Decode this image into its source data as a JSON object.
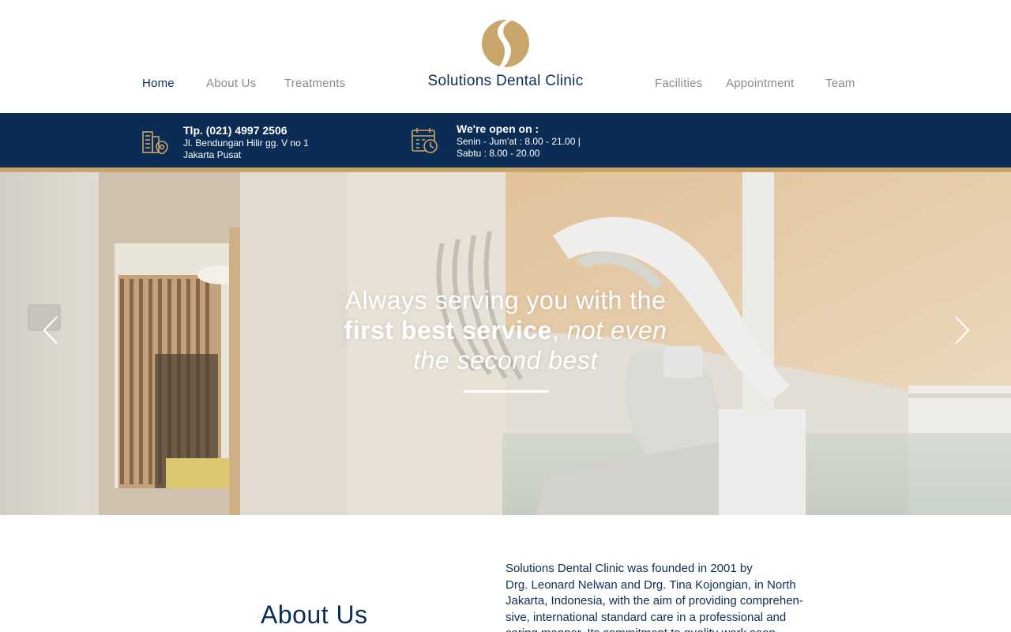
{
  "nav": {
    "left": [
      "Home",
      "About Us",
      "Treatments"
    ],
    "right": [
      "Facilities",
      "Appointment",
      "Team"
    ],
    "active": "Home"
  },
  "brand": {
    "name": "Solutions Dental Clinic",
    "logo_icon": "s-swirl-logo-icon",
    "gold": "#c8a66a",
    "navy": "#0b2d55"
  },
  "contact": {
    "phone": "Tlp. (021) 4997 2506",
    "address_line1": "Jl. Bendungan Hilir gg. V no 1",
    "address_line2": "Jakarta Pusat",
    "icon": "building-location-icon"
  },
  "hours": {
    "heading": "We're open on :",
    "weekdays": "Senin - Jum'at : 8.00 - 21.00 |",
    "saturday": "Sabtu : 8.00 - 20.00",
    "icon": "calendar-clock-icon"
  },
  "hero": {
    "line1": "Always serving you with the",
    "bold": "first best service",
    "comma": ",",
    "italic1": "not even",
    "italic2": "the second best",
    "prev_icon": "chevron-left-icon",
    "next_icon": "chevron-right-icon"
  },
  "about": {
    "title": "About Us",
    "lines": [
      "Solutions Dental Clinic was founded in 2001 by",
      "Drg. Leonard Nelwan and Drg. Tina Kojongian, in North",
      "Jakarta, Indonesia, with the aim of providing comprehen-",
      "sive, international standard care in a professional and",
      "caring manner. Its commitment to quality work soon"
    ]
  }
}
